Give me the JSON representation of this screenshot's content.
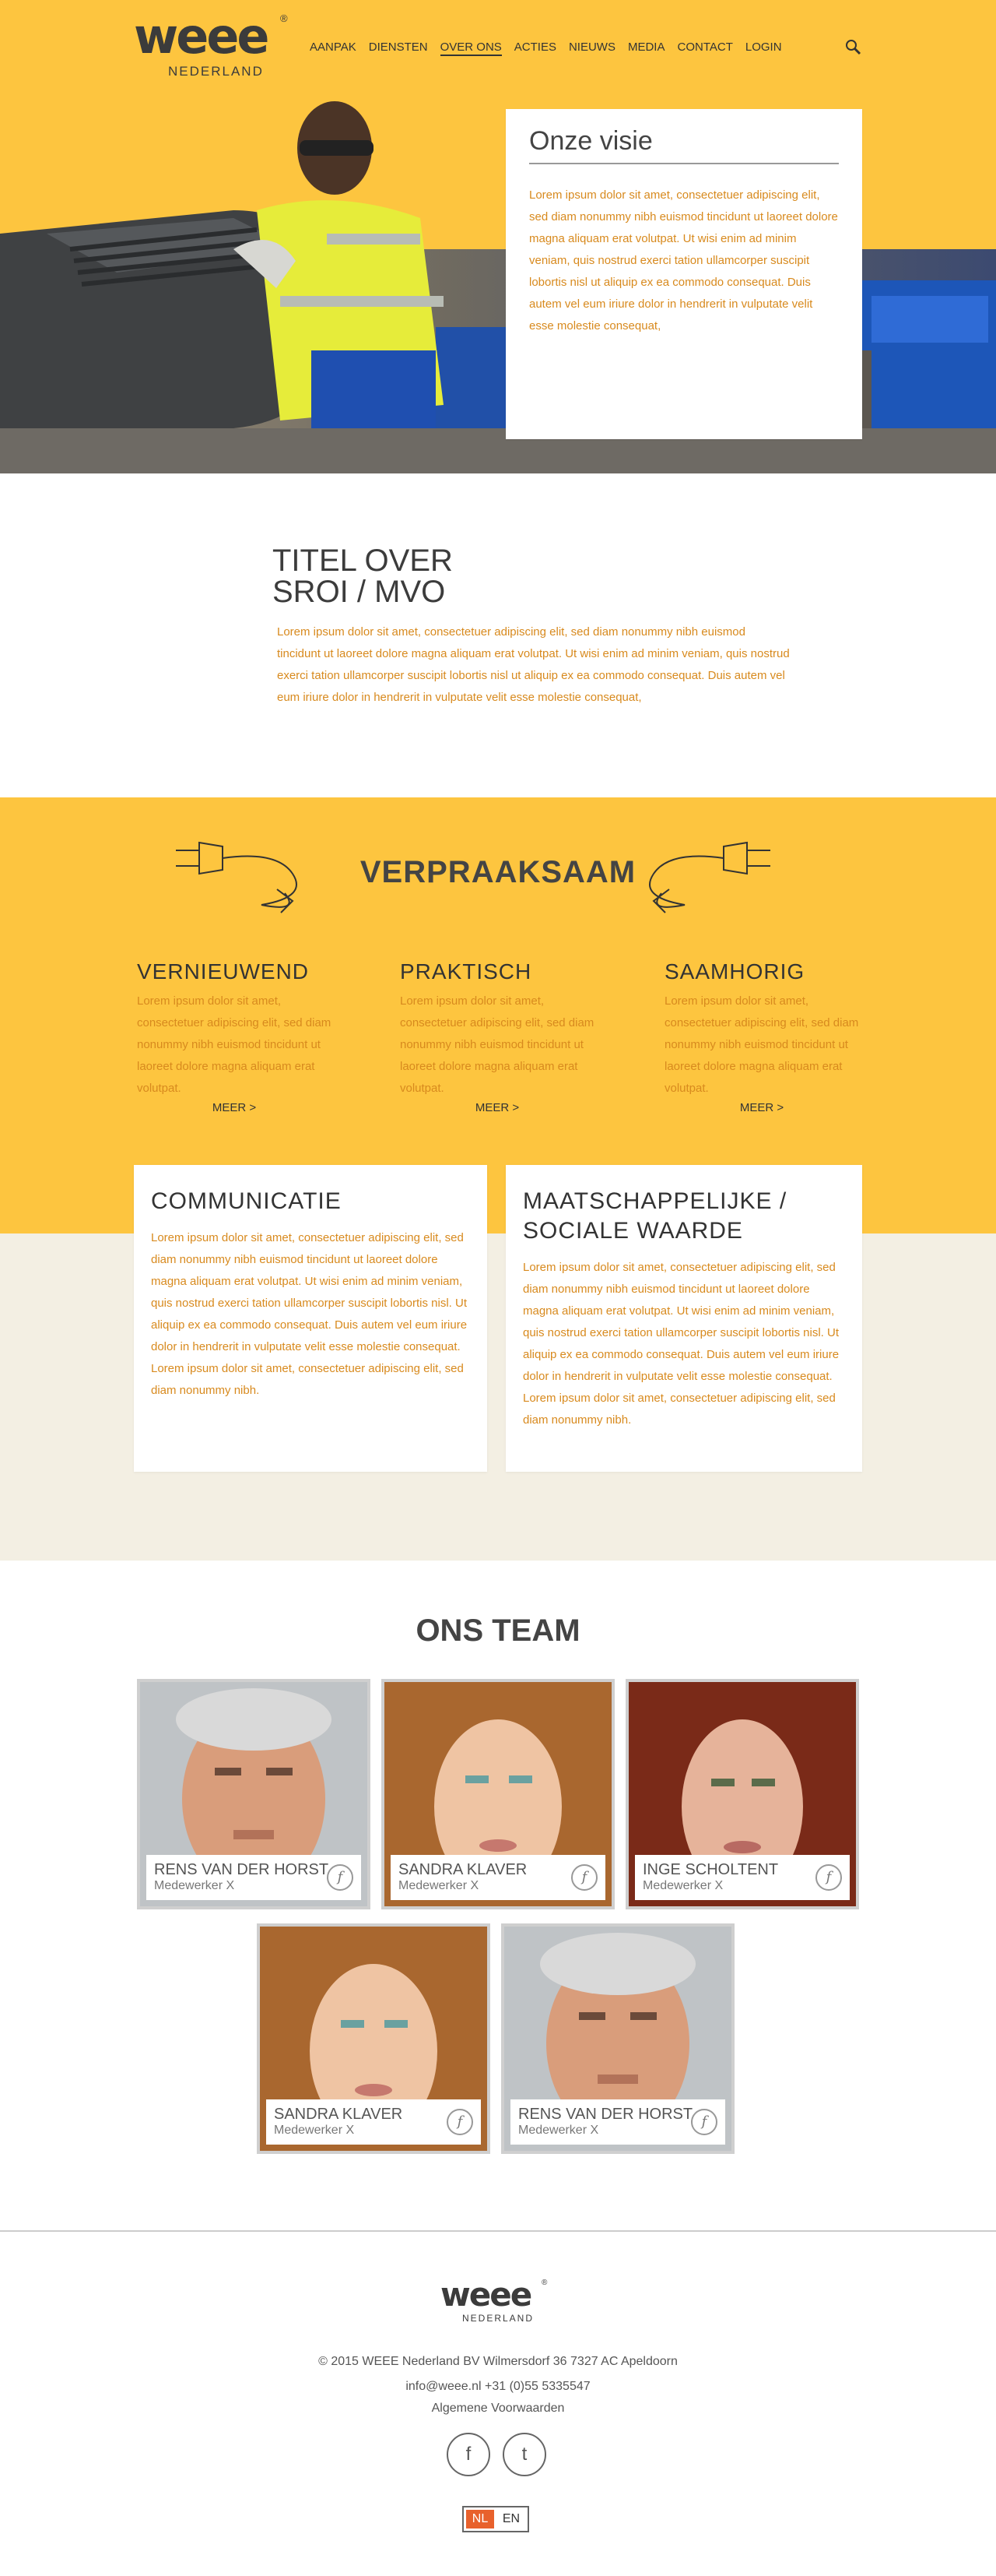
{
  "brand": {
    "logo_word": "weee",
    "logo_registered": "®",
    "logo_sub": "NEDERLAND"
  },
  "nav": {
    "items": [
      "AANPAK",
      "DIENSTEN",
      "OVER ONS",
      "ACTIES",
      "NIEUWS",
      "MEDIA",
      "CONTACT",
      "LOGIN"
    ],
    "active": "OVER ONS",
    "search_icon": "search-icon"
  },
  "vision": {
    "title": "Onze visie",
    "text": "Lorem ipsum dolor sit amet, consectetuer adipiscing elit, sed diam nonummy nibh euismod tincidunt ut laoreet dolore magna aliquam erat volutpat. Ut wisi enim ad minim veniam, quis nostrud exerci tation ullamcorper suscipit lobortis nisl ut aliquip ex ea commodo consequat. Duis autem vel eum iriure dolor in hendrerit in vulputate velit esse molestie consequat,"
  },
  "sroi": {
    "title_line1": "TITEL OVER",
    "title_line2": "SROI / MVO",
    "text": "Lorem ipsum dolor sit amet, consectetuer adipiscing elit, sed diam nonummy nibh euismod tincidunt ut laoreet dolore magna aliquam erat volutpat. Ut wisi enim ad minim veniam, quis nostrud exerci tation ullamcorper suscipit lobortis nisl ut aliquip ex ea commodo consequat. Duis autem vel eum iriure dolor in hendrerit in vulputate velit esse molestie consequat,"
  },
  "verpraaksaam": {
    "title": "VERPRAAKSAAM",
    "columns": [
      {
        "title": "VERNIEUWEND",
        "text": "Lorem ipsum dolor sit amet, consectetuer adipiscing elit, sed diam nonummy nibh euismod tincidunt ut laoreet dolore magna aliquam erat volutpat.",
        "more": "MEER >"
      },
      {
        "title": "PRAKTISCH",
        "text": "Lorem ipsum dolor sit amet, consectetuer adipiscing elit, sed diam nonummy nibh euismod tincidunt ut laoreet dolore magna aliquam erat volutpat.",
        "more": "MEER >"
      },
      {
        "title": "SAAMHORIG",
        "text": "Lorem ipsum dolor sit amet, consectetuer adipiscing elit, sed diam nonummy nibh euismod tincidunt ut laoreet dolore magna aliquam erat volutpat.",
        "more": "MEER >"
      }
    ],
    "cards": [
      {
        "title": "COMMUNICATIE",
        "text": "Lorem ipsum dolor sit amet, consectetuer adipiscing elit, sed diam nonummy nibh euismod tincidunt ut laoreet dolore magna aliquam erat volutpat. Ut wisi enim ad minim veniam, quis nostrud exerci tation ullamcorper suscipit lobortis nisl. Ut aliquip ex ea commodo consequat. Duis autem vel eum iriure dolor in hendrerit in vulputate velit esse molestie consequat. Lorem ipsum dolor sit amet, consectetuer adipiscing elit, sed diam nonummy nibh."
      },
      {
        "title": "MAATSCHAPPELIJKE / SOCIALE WAARDE",
        "text": "Lorem ipsum dolor sit amet, consectetuer adipiscing elit, sed diam nonummy nibh euismod tincidunt ut laoreet dolore magna aliquam erat volutpat. Ut wisi enim ad minim veniam, quis nostrud exerci tation ullamcorper suscipit lobortis nisl. Ut aliquip ex ea commodo consequat. Duis autem vel eum iriure dolor in hendrerit in vulputate velit esse molestie consequat. Lorem ipsum dolor sit amet, consectetuer adipiscing elit, sed diam nonummy nibh."
      }
    ]
  },
  "team": {
    "title": "ONS TEAM",
    "members": [
      {
        "name": "RENS VAN DER HORST",
        "role": "Medewerker X",
        "icon": "facebook-icon"
      },
      {
        "name": "SANDRA KLAVER",
        "role": "Medewerker X",
        "icon": "facebook-icon"
      },
      {
        "name": "INGE SCHOLTENT",
        "role": "Medewerker X",
        "icon": "facebook-icon"
      },
      {
        "name": "SANDRA KLAVER",
        "role": "Medewerker X",
        "icon": "facebook-icon"
      },
      {
        "name": "RENS VAN DER HORST",
        "role": "Medewerker X",
        "icon": "facebook-icon"
      }
    ]
  },
  "footer": {
    "copyright": "© 2015   WEEE Nederland BV   Wilmersdorf 36   7327 AC Apeldoorn",
    "contact": "info@weee.nl   +31 (0)55 5335547",
    "terms": "Algemene Voorwaarden",
    "social": [
      "facebook-icon",
      "twitter-icon"
    ],
    "lang": {
      "nl": "NL",
      "en": "EN",
      "active": "NL"
    }
  },
  "colors": {
    "accent_yellow": "#fdc53f",
    "body_text_orange": "#d88a1e",
    "lang_active": "#e8612c",
    "beige": "#f3efe3"
  }
}
